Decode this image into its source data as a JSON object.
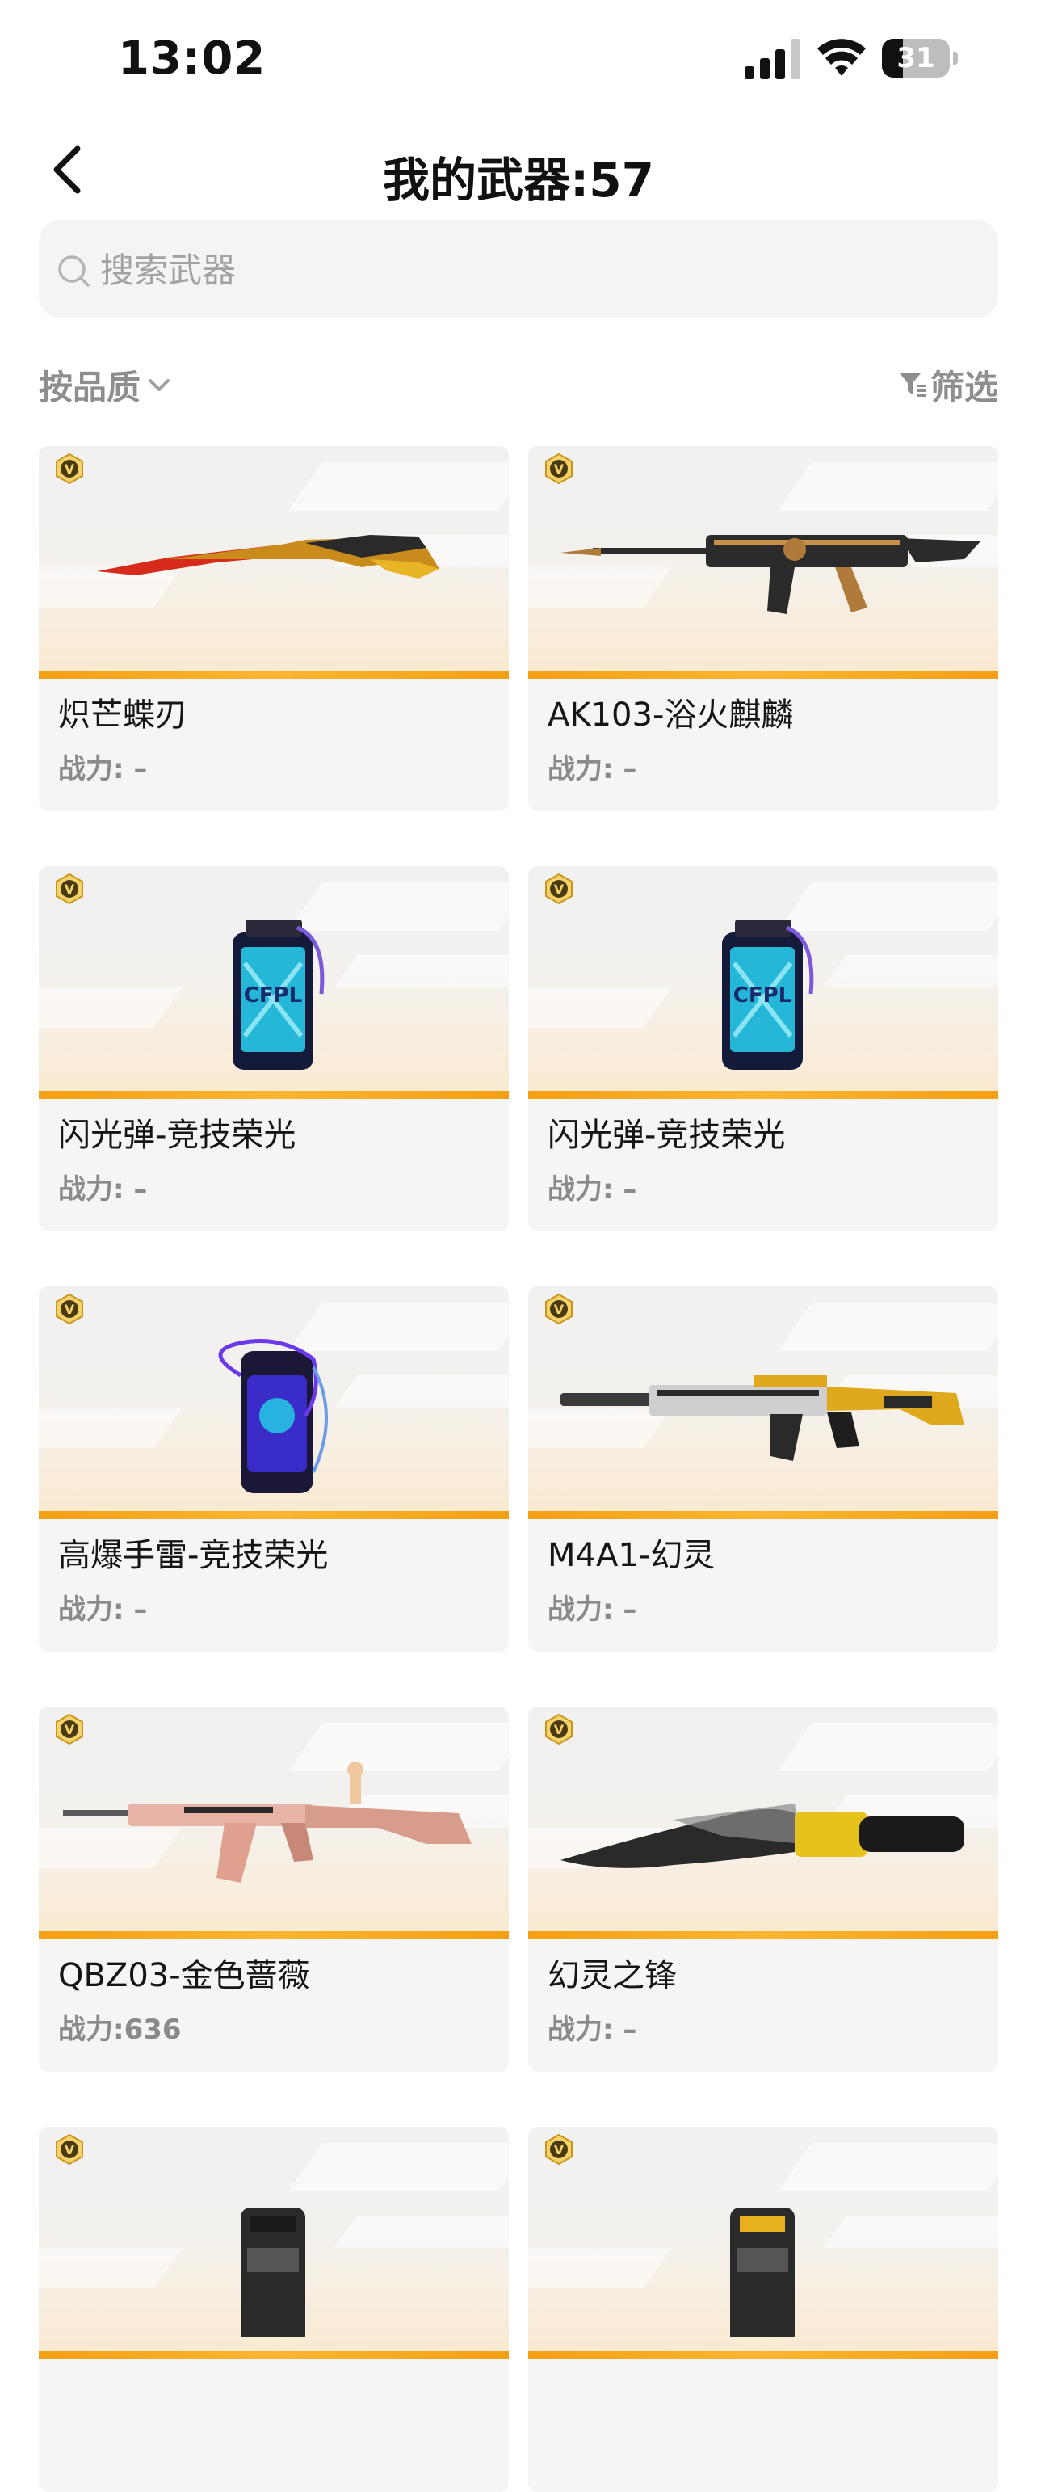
{
  "status_bar": {
    "time": "13:02",
    "battery_level": "31",
    "icons": [
      "signal-icon",
      "wifi-icon",
      "battery-icon"
    ]
  },
  "header": {
    "back_icon": "chevron-left-icon",
    "title": "我的武器:57"
  },
  "search": {
    "placeholder": "搜索武器",
    "value": ""
  },
  "toolbar": {
    "sort_label": "按品质",
    "filter_label": "筛选"
  },
  "cards": [
    {
      "name": "炽芒蝶刃",
      "power": "战力: –",
      "badge": "V"
    },
    {
      "name": "AK103-浴火麒麟",
      "power": "战力: –",
      "badge": "V"
    },
    {
      "name": "闪光弹-竞技荣光",
      "power": "战力: –",
      "badge": "V"
    },
    {
      "name": "闪光弹-竞技荣光",
      "power": "战力: –",
      "badge": "V"
    },
    {
      "name": "高爆手雷-竞技荣光",
      "power": "战力: –",
      "badge": "V"
    },
    {
      "name": "M4A1-幻灵",
      "power": "战力: –",
      "badge": "V"
    },
    {
      "name": "QBZ03-金色蔷薇",
      "power": "战力:636",
      "badge": "V"
    },
    {
      "name": "幻灵之锋",
      "power": "战力: –",
      "badge": "V"
    },
    {
      "name": "",
      "power": "",
      "badge": "V"
    },
    {
      "name": "",
      "power": "",
      "badge": "V"
    }
  ],
  "colors": {
    "accent_bar": "#f4a016",
    "card_bg": "#f5f5f5",
    "muted_text": "#8e8e8e"
  }
}
